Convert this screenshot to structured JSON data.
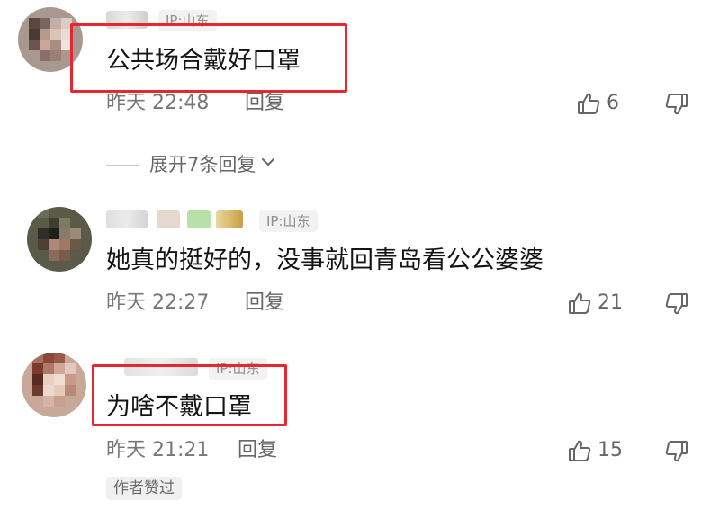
{
  "comments": [
    {
      "ip": "IP:山东",
      "text": "公共场合戴好口罩",
      "time": "昨天 22:48",
      "reply_label": "回复",
      "likes": "6"
    },
    {
      "ip": "IP:山东",
      "text": "她真的挺好的，没事就回青岛看公公婆婆",
      "time": "昨天 22:27",
      "reply_label": "回复",
      "likes": "21"
    },
    {
      "ip": "IP:山东",
      "text": "为啥不戴口罩",
      "time": "昨天 21:21",
      "reply_label": "回复",
      "likes": "15",
      "author_badge": "作者赞过"
    }
  ],
  "expand_replies": {
    "label": "展开7条回复"
  },
  "icons": {
    "like": "thumbs-up-icon",
    "dislike": "thumbs-down-icon",
    "expand": "chevron-down-icon"
  },
  "colors": {
    "highlight_box": "#e8262d",
    "meta_text": "#777777",
    "comment_text": "#141414"
  }
}
